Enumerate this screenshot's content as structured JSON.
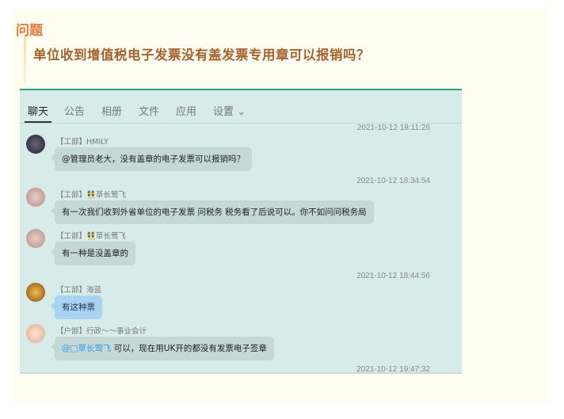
{
  "question": {
    "label": "问题",
    "title": "单位收到增值税电子发票没有盖发票专用章可以报销吗？"
  },
  "tabs": [
    {
      "label": "聊天",
      "active": true
    },
    {
      "label": "公告"
    },
    {
      "label": "相册"
    },
    {
      "label": "文件"
    },
    {
      "label": "应用"
    },
    {
      "label": "设置 ⌄"
    }
  ],
  "colors": {
    "accent": "#27a27a",
    "question_label": "#e07b3a",
    "title": "#a4632b"
  },
  "messages": [
    {
      "time": "2021-10-12 18:11:26",
      "sender": "【工部】HMILY",
      "text": "@管理员老大，没有盖章的电子发票可以报销吗？"
    },
    {
      "time": "2021-10-12 18:34:54",
      "sender": "【工部】👯草长莺飞",
      "text": "有一次我们收到外省单位的电子发票 问税务 税务看了后说可以。你不如问问税务局"
    },
    {
      "sender": "【工部】👯草长莺飞",
      "text": "有一种是没盖章的"
    },
    {
      "time": "2021-10-12 18:44:56",
      "sender": "【工部】海蓝",
      "text": "有这种票"
    },
    {
      "sender": "【户部】行政～～事业会计",
      "mention": "@□草长莺飞",
      "text": " 可以，现在用UK开的都没有发票电子签章"
    },
    {
      "time": "2021-10-12 19:47:32"
    }
  ]
}
